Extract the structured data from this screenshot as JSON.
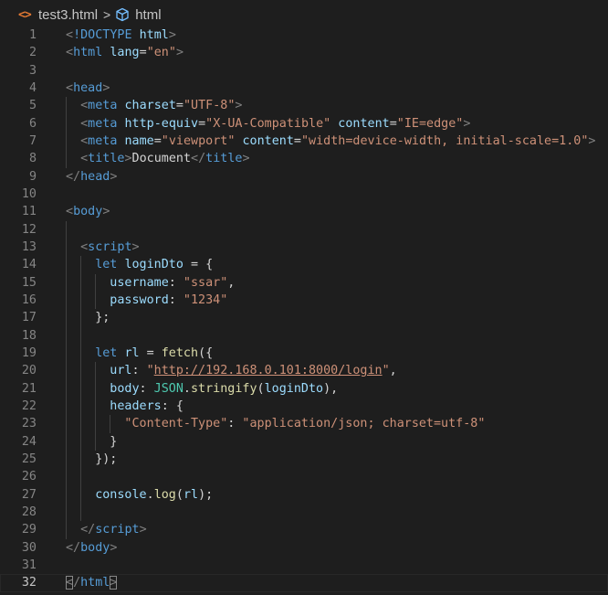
{
  "breadcrumb": {
    "file_icon": "<>",
    "file_name": "test3.html",
    "separator": ">",
    "symbol_icon": "cube-icon",
    "symbol_name": "html"
  },
  "colors": {
    "background": "#1e1e1e",
    "tag": "#569cd6",
    "bracket": "#808080",
    "attribute": "#9cdcfe",
    "string": "#ce9178",
    "function": "#dcdcaa",
    "class": "#4ec9b0",
    "text": "#d4d4d4",
    "line_number": "#858585"
  },
  "editor": {
    "current_line": 32,
    "lines": [
      {
        "n": "1",
        "indent": 0,
        "tokens": [
          [
            "br",
            "<"
          ],
          [
            "tag",
            "!DOCTYPE"
          ],
          [
            "pl",
            " "
          ],
          [
            "attr",
            "html"
          ],
          [
            "br",
            ">"
          ]
        ]
      },
      {
        "n": "2",
        "indent": 0,
        "tokens": [
          [
            "br",
            "<"
          ],
          [
            "tag",
            "html"
          ],
          [
            "pl",
            " "
          ],
          [
            "attr",
            "lang"
          ],
          [
            "pl",
            "="
          ],
          [
            "str",
            "\"en\""
          ],
          [
            "br",
            ">"
          ]
        ]
      },
      {
        "n": "3",
        "indent": 0,
        "tokens": []
      },
      {
        "n": "4",
        "indent": 0,
        "tokens": [
          [
            "br",
            "<"
          ],
          [
            "tag",
            "head"
          ],
          [
            "br",
            ">"
          ]
        ]
      },
      {
        "n": "5",
        "indent": 1,
        "tokens": [
          [
            "br",
            "<"
          ],
          [
            "tag",
            "meta"
          ],
          [
            "pl",
            " "
          ],
          [
            "attr",
            "charset"
          ],
          [
            "pl",
            "="
          ],
          [
            "str",
            "\"UTF-8\""
          ],
          [
            "br",
            ">"
          ]
        ]
      },
      {
        "n": "6",
        "indent": 1,
        "tokens": [
          [
            "br",
            "<"
          ],
          [
            "tag",
            "meta"
          ],
          [
            "pl",
            " "
          ],
          [
            "attr",
            "http-equiv"
          ],
          [
            "pl",
            "="
          ],
          [
            "str",
            "\"X-UA-Compatible\""
          ],
          [
            "pl",
            " "
          ],
          [
            "attr",
            "content"
          ],
          [
            "pl",
            "="
          ],
          [
            "str",
            "\"IE=edge\""
          ],
          [
            "br",
            ">"
          ]
        ]
      },
      {
        "n": "7",
        "indent": 1,
        "tokens": [
          [
            "br",
            "<"
          ],
          [
            "tag",
            "meta"
          ],
          [
            "pl",
            " "
          ],
          [
            "attr",
            "name"
          ],
          [
            "pl",
            "="
          ],
          [
            "str",
            "\"viewport\""
          ],
          [
            "pl",
            " "
          ],
          [
            "attr",
            "content"
          ],
          [
            "pl",
            "="
          ],
          [
            "str",
            "\"width=device-width, initial-scale=1.0\""
          ],
          [
            "br",
            ">"
          ]
        ]
      },
      {
        "n": "8",
        "indent": 1,
        "tokens": [
          [
            "br",
            "<"
          ],
          [
            "tag",
            "title"
          ],
          [
            "br",
            ">"
          ],
          [
            "pl",
            "Document"
          ],
          [
            "br",
            "</"
          ],
          [
            "tag",
            "title"
          ],
          [
            "br",
            ">"
          ]
        ]
      },
      {
        "n": "9",
        "indent": 0,
        "tokens": [
          [
            "br",
            "</"
          ],
          [
            "tag",
            "head"
          ],
          [
            "br",
            ">"
          ]
        ]
      },
      {
        "n": "10",
        "indent": 0,
        "tokens": []
      },
      {
        "n": "11",
        "indent": 0,
        "tokens": [
          [
            "br",
            "<"
          ],
          [
            "tag",
            "body"
          ],
          [
            "br",
            ">"
          ]
        ]
      },
      {
        "n": "12",
        "indent": 1,
        "tokens": []
      },
      {
        "n": "13",
        "indent": 1,
        "tokens": [
          [
            "br",
            "<"
          ],
          [
            "tag",
            "script"
          ],
          [
            "br",
            ">"
          ]
        ]
      },
      {
        "n": "14",
        "indent": 2,
        "tokens": [
          [
            "kw",
            "let"
          ],
          [
            "pl",
            " "
          ],
          [
            "var",
            "loginDto"
          ],
          [
            "pl",
            " = {"
          ]
        ]
      },
      {
        "n": "15",
        "indent": 3,
        "tokens": [
          [
            "var",
            "username"
          ],
          [
            "pl",
            ": "
          ],
          [
            "str",
            "\"ssar\""
          ],
          [
            "pl",
            ","
          ]
        ]
      },
      {
        "n": "16",
        "indent": 3,
        "tokens": [
          [
            "var",
            "password"
          ],
          [
            "pl",
            ": "
          ],
          [
            "str",
            "\"1234\""
          ]
        ]
      },
      {
        "n": "17",
        "indent": 2,
        "tokens": [
          [
            "pl",
            "};"
          ]
        ]
      },
      {
        "n": "18",
        "indent": 2,
        "tokens": []
      },
      {
        "n": "19",
        "indent": 2,
        "tokens": [
          [
            "kw",
            "let"
          ],
          [
            "pl",
            " "
          ],
          [
            "var",
            "rl"
          ],
          [
            "pl",
            " = "
          ],
          [
            "fn",
            "fetch"
          ],
          [
            "pl",
            "({"
          ]
        ]
      },
      {
        "n": "20",
        "indent": 3,
        "tokens": [
          [
            "var",
            "url"
          ],
          [
            "pl",
            ": "
          ],
          [
            "str",
            "\""
          ],
          [
            "url",
            "http://192.168.0.101:8000/login"
          ],
          [
            "str",
            "\""
          ],
          [
            "pl",
            ","
          ]
        ]
      },
      {
        "n": "21",
        "indent": 3,
        "tokens": [
          [
            "var",
            "body"
          ],
          [
            "pl",
            ": "
          ],
          [
            "cls",
            "JSON"
          ],
          [
            "pl",
            "."
          ],
          [
            "fn",
            "stringify"
          ],
          [
            "pl",
            "("
          ],
          [
            "var",
            "loginDto"
          ],
          [
            "pl",
            "),"
          ]
        ]
      },
      {
        "n": "22",
        "indent": 3,
        "tokens": [
          [
            "var",
            "headers"
          ],
          [
            "pl",
            ": {"
          ]
        ]
      },
      {
        "n": "23",
        "indent": 4,
        "tokens": [
          [
            "str",
            "\"Content-Type\""
          ],
          [
            "pl",
            ": "
          ],
          [
            "str",
            "\"application/json; charset=utf-8\""
          ]
        ]
      },
      {
        "n": "24",
        "indent": 3,
        "tokens": [
          [
            "pl",
            "}"
          ]
        ]
      },
      {
        "n": "25",
        "indent": 2,
        "tokens": [
          [
            "pl",
            "});"
          ]
        ]
      },
      {
        "n": "26",
        "indent": 2,
        "tokens": []
      },
      {
        "n": "27",
        "indent": 2,
        "tokens": [
          [
            "var",
            "console"
          ],
          [
            "pl",
            "."
          ],
          [
            "fn",
            "log"
          ],
          [
            "pl",
            "("
          ],
          [
            "var",
            "rl"
          ],
          [
            "pl",
            ");"
          ]
        ]
      },
      {
        "n": "28",
        "indent": 2,
        "tokens": []
      },
      {
        "n": "29",
        "indent": 1,
        "tokens": [
          [
            "br",
            "</"
          ],
          [
            "tag",
            "script"
          ],
          [
            "br",
            ">"
          ]
        ]
      },
      {
        "n": "30",
        "indent": 0,
        "tokens": [
          [
            "br",
            "</"
          ],
          [
            "tag",
            "body"
          ],
          [
            "br",
            ">"
          ]
        ]
      },
      {
        "n": "31",
        "indent": 0,
        "tokens": []
      },
      {
        "n": "32",
        "indent": 0,
        "tokens": [
          [
            "br match",
            "<"
          ],
          [
            "br",
            "/"
          ],
          [
            "tag",
            "html"
          ],
          [
            "br match",
            ">"
          ]
        ]
      }
    ]
  }
}
